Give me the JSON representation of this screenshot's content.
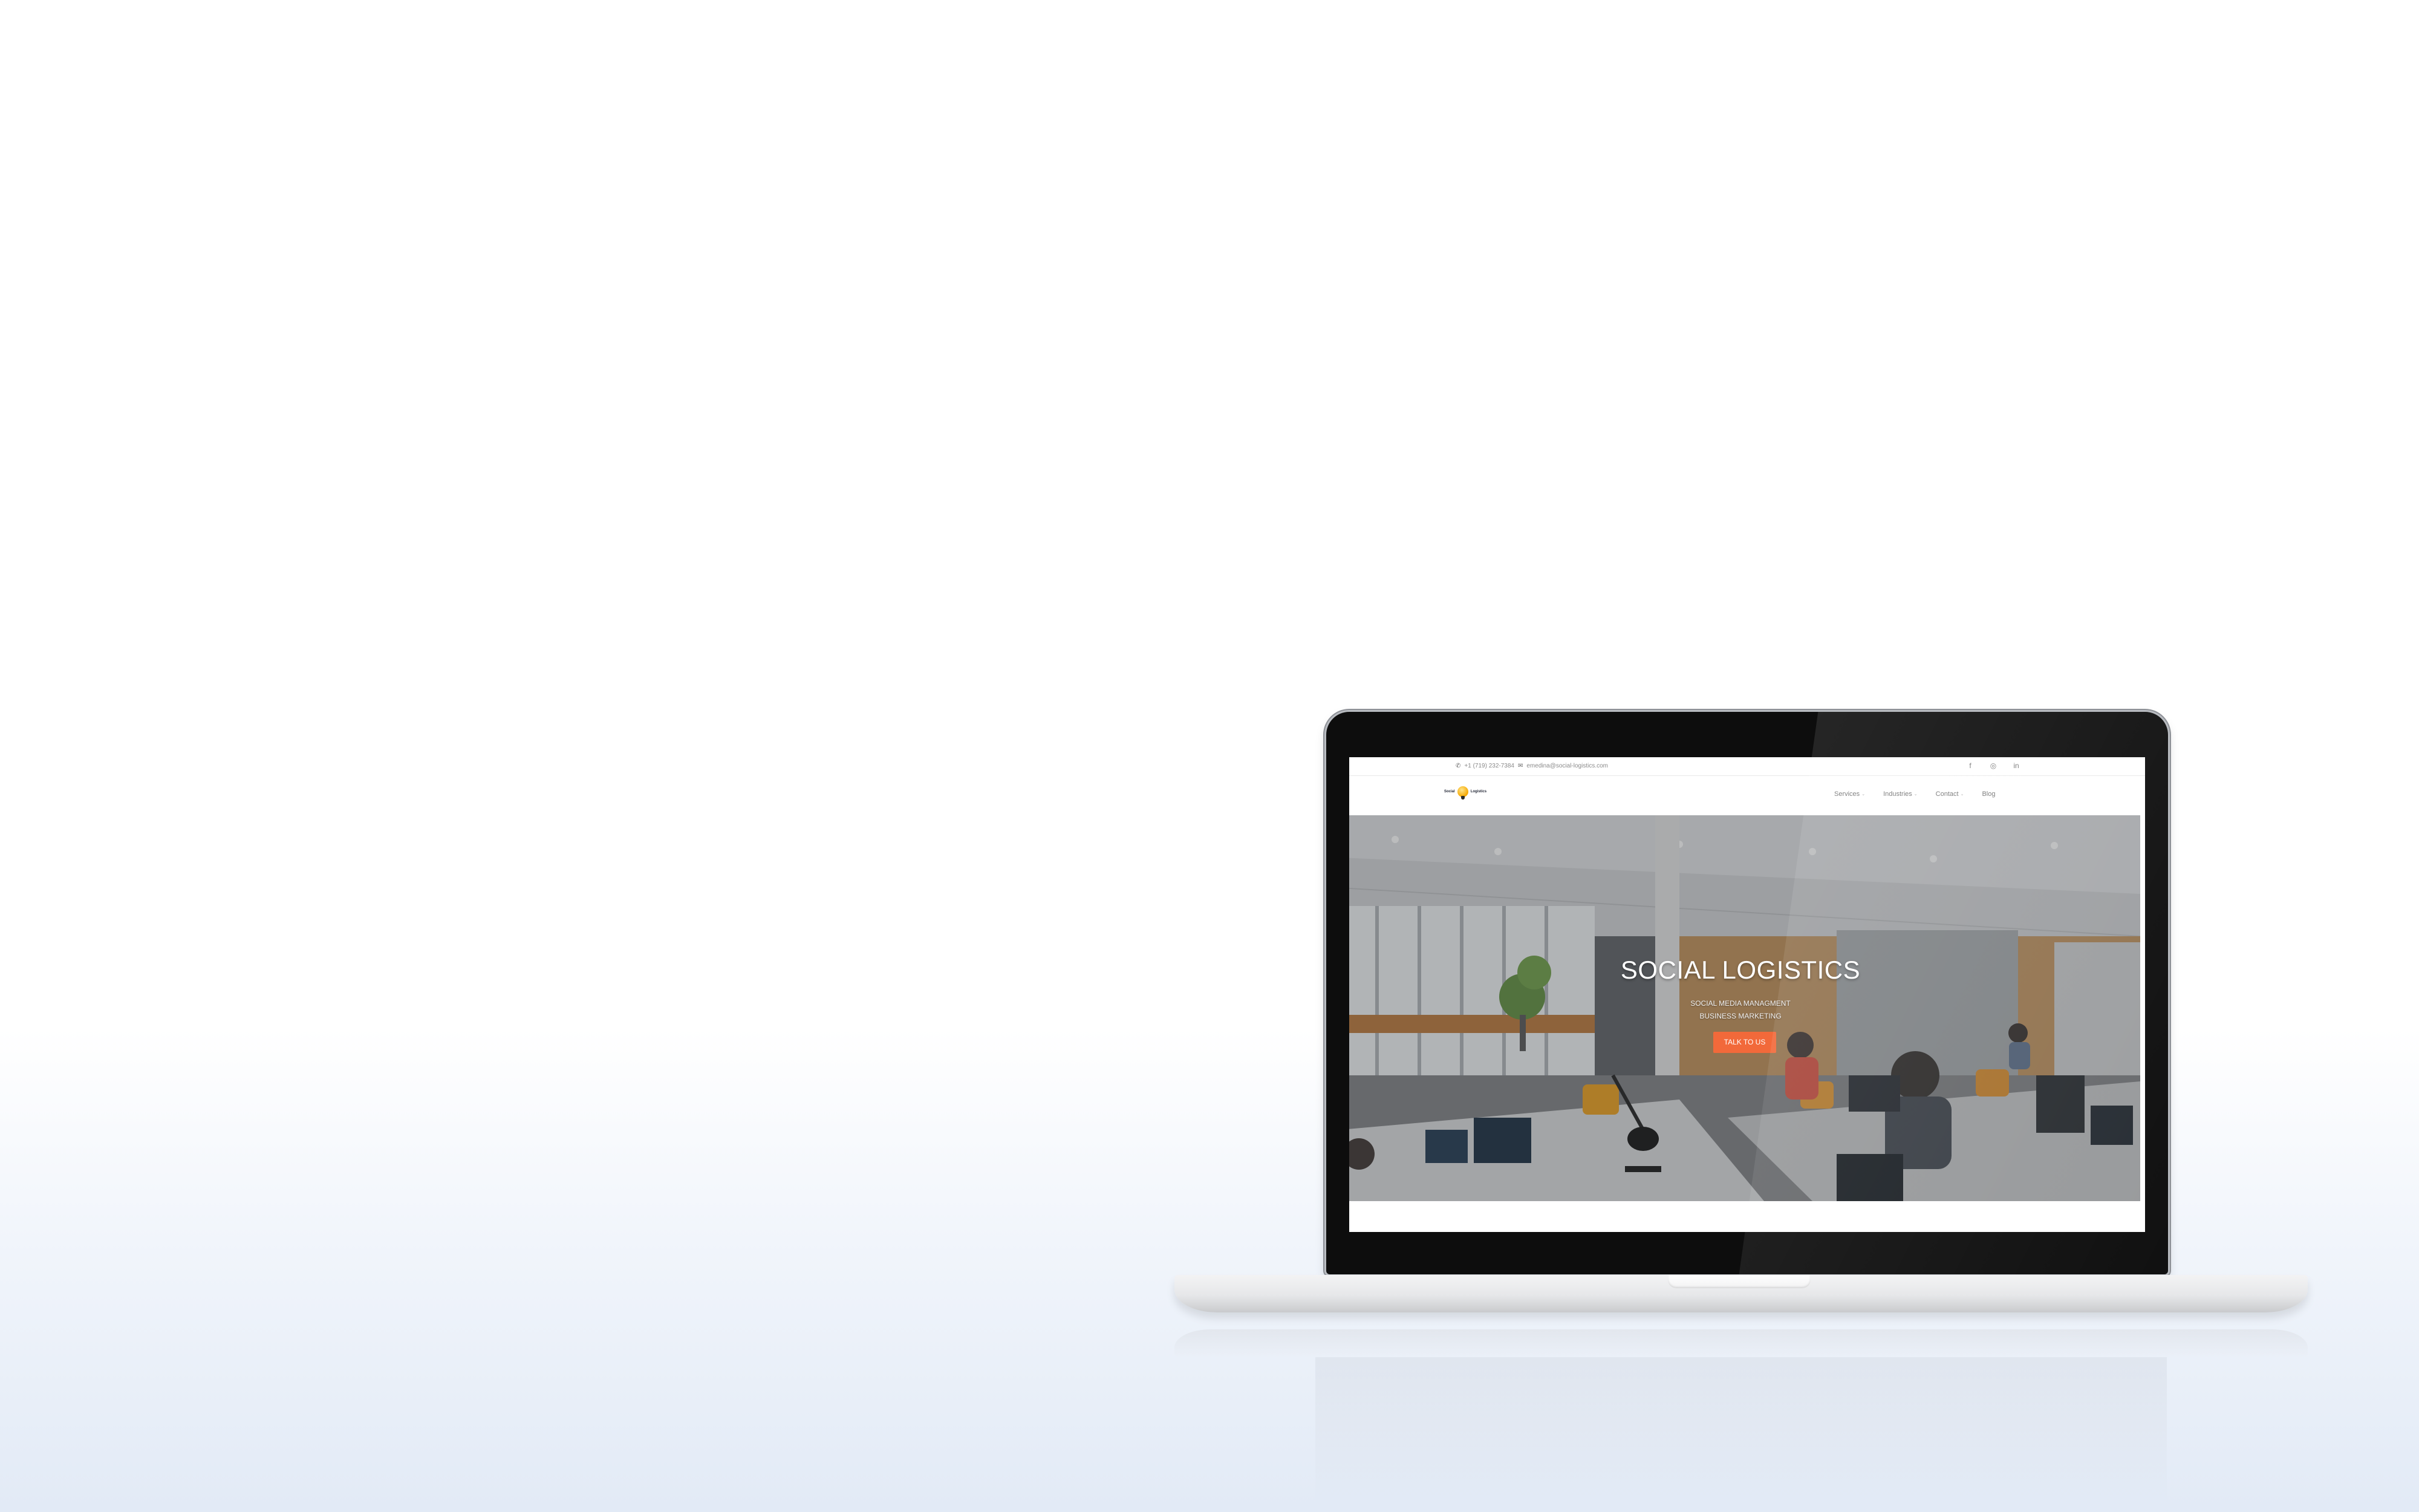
{
  "colors": {
    "accent": "#f2693a",
    "hero_text": "#ffffff",
    "nav_text": "#777777",
    "background": "#ffffff"
  },
  "topbar": {
    "phone": "+1 (719) 232-7384",
    "email": "emedina@social-logistics.com",
    "phone_icon": "phone-icon",
    "email_icon": "envelope-icon",
    "social": [
      {
        "icon": "facebook-icon",
        "glyph": "f"
      },
      {
        "icon": "instagram-icon",
        "glyph": "◎"
      },
      {
        "icon": "linkedin-icon",
        "glyph": "in"
      }
    ]
  },
  "navbar": {
    "logo_text_left": "Social",
    "logo_text_right": "Logistics",
    "items": [
      {
        "label": "Services",
        "has_dropdown": true
      },
      {
        "label": "Industries",
        "has_dropdown": true
      },
      {
        "label": "Contact",
        "has_dropdown": true
      },
      {
        "label": "Blog",
        "has_dropdown": false
      }
    ]
  },
  "hero": {
    "title": "SOCIAL LOGISTICS",
    "subtitle_1": "SOCIAL MEDIA MANAGMENT",
    "subtitle_2": "BUSINESS MARKETING",
    "cta_label": "TALK TO US"
  }
}
